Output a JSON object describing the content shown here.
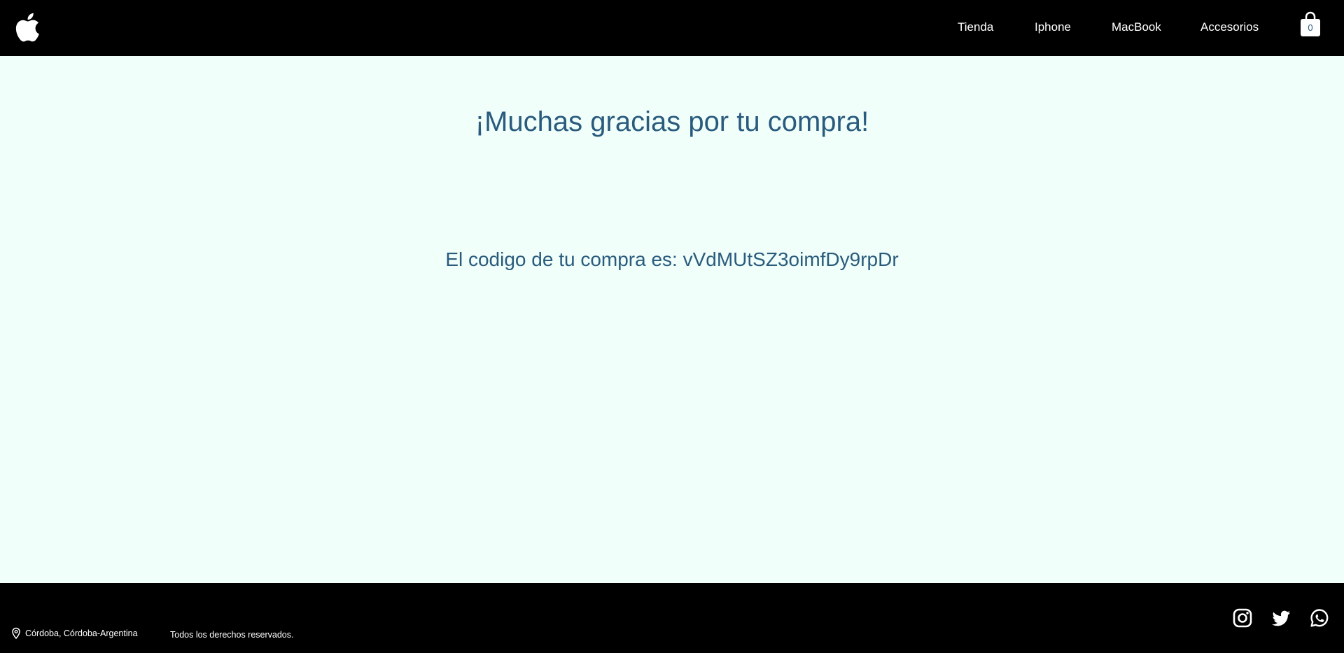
{
  "header": {
    "logo": "apple-logo",
    "nav": [
      {
        "label": "Tienda"
      },
      {
        "label": "Iphone"
      },
      {
        "label": "MacBook"
      },
      {
        "label": "Accesorios"
      }
    ],
    "cart": {
      "icon": "shopping-bag-icon",
      "count": "0"
    }
  },
  "main": {
    "title": "¡Muchas gracias por tu compra!",
    "code_text": "El codigo de tu compra es: vVdMUtSZ3oimfDy9rpDr"
  },
  "footer": {
    "location": "Córdoba, Córdoba-Argentina",
    "rights": "Todos los derechos reservados.",
    "social": [
      "instagram-icon",
      "twitter-icon",
      "whatsapp-icon"
    ]
  },
  "colors": {
    "header_bg": "#000000",
    "page_bg": "#f0fff9",
    "text_accent": "#2a5b7e"
  }
}
